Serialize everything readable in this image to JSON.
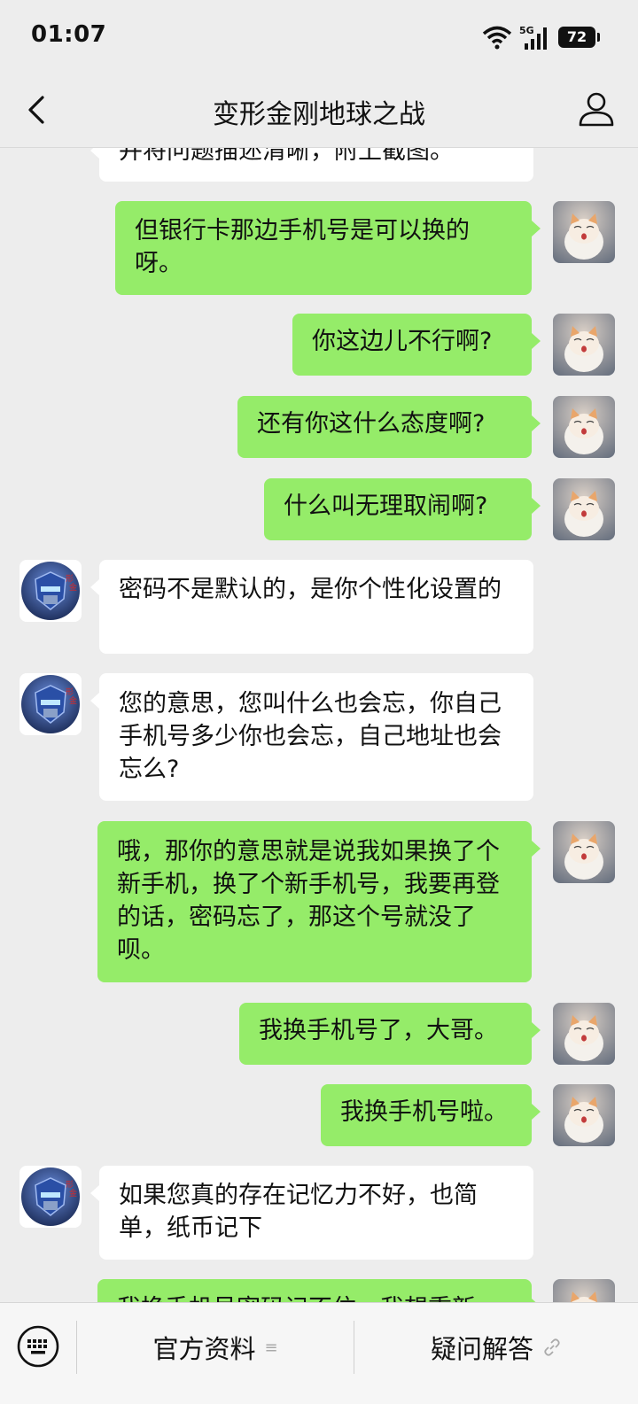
{
  "status_bar": {
    "time": "01:07",
    "network": "5G",
    "battery": "72",
    "icons": [
      "wifi-icon",
      "signal-5g-icon",
      "battery-icon"
    ]
  },
  "nav": {
    "title": "变形金刚地球之战",
    "back_icon": "chevron-left-icon",
    "profile_icon": "person-icon"
  },
  "messages": [
    {
      "side": "in",
      "text": "并将问题描述清晰，附上截图。"
    },
    {
      "side": "out",
      "text": "但银行卡那边手机号是可以换的呀。"
    },
    {
      "side": "out",
      "text": "你这边儿不行啊?"
    },
    {
      "side": "out",
      "text": "还有你这什么态度啊?"
    },
    {
      "side": "out",
      "text": "什么叫无理取闹啊?"
    },
    {
      "side": "in",
      "text": "密码不是默认的，是你个性化设置的"
    },
    {
      "side": "in",
      "text": "您的意思，您叫什么也会忘，你自己手机号多少你也会忘，自己地址也会忘么?"
    },
    {
      "side": "out",
      "text": "哦，那你的意思就是说我如果换了个新手机，换了个新手机号，我要再登的话，密码忘了，那这个号就没了呗。"
    },
    {
      "side": "out",
      "text": "我换手机号了，大哥。"
    },
    {
      "side": "out",
      "text": "我换手机号啦。"
    },
    {
      "side": "in",
      "text": "如果您真的存在记忆力不好，也简单，纸币记下"
    },
    {
      "side": "out",
      "text": "我换手机号密码记不住，我想重新"
    }
  ],
  "bottom": {
    "keyboard_icon": "keyboard-icon",
    "menu1": "官方资料",
    "menu1_icon": "menu-lines-icon",
    "menu2": "疑问解答",
    "menu2_icon": "link-icon"
  }
}
